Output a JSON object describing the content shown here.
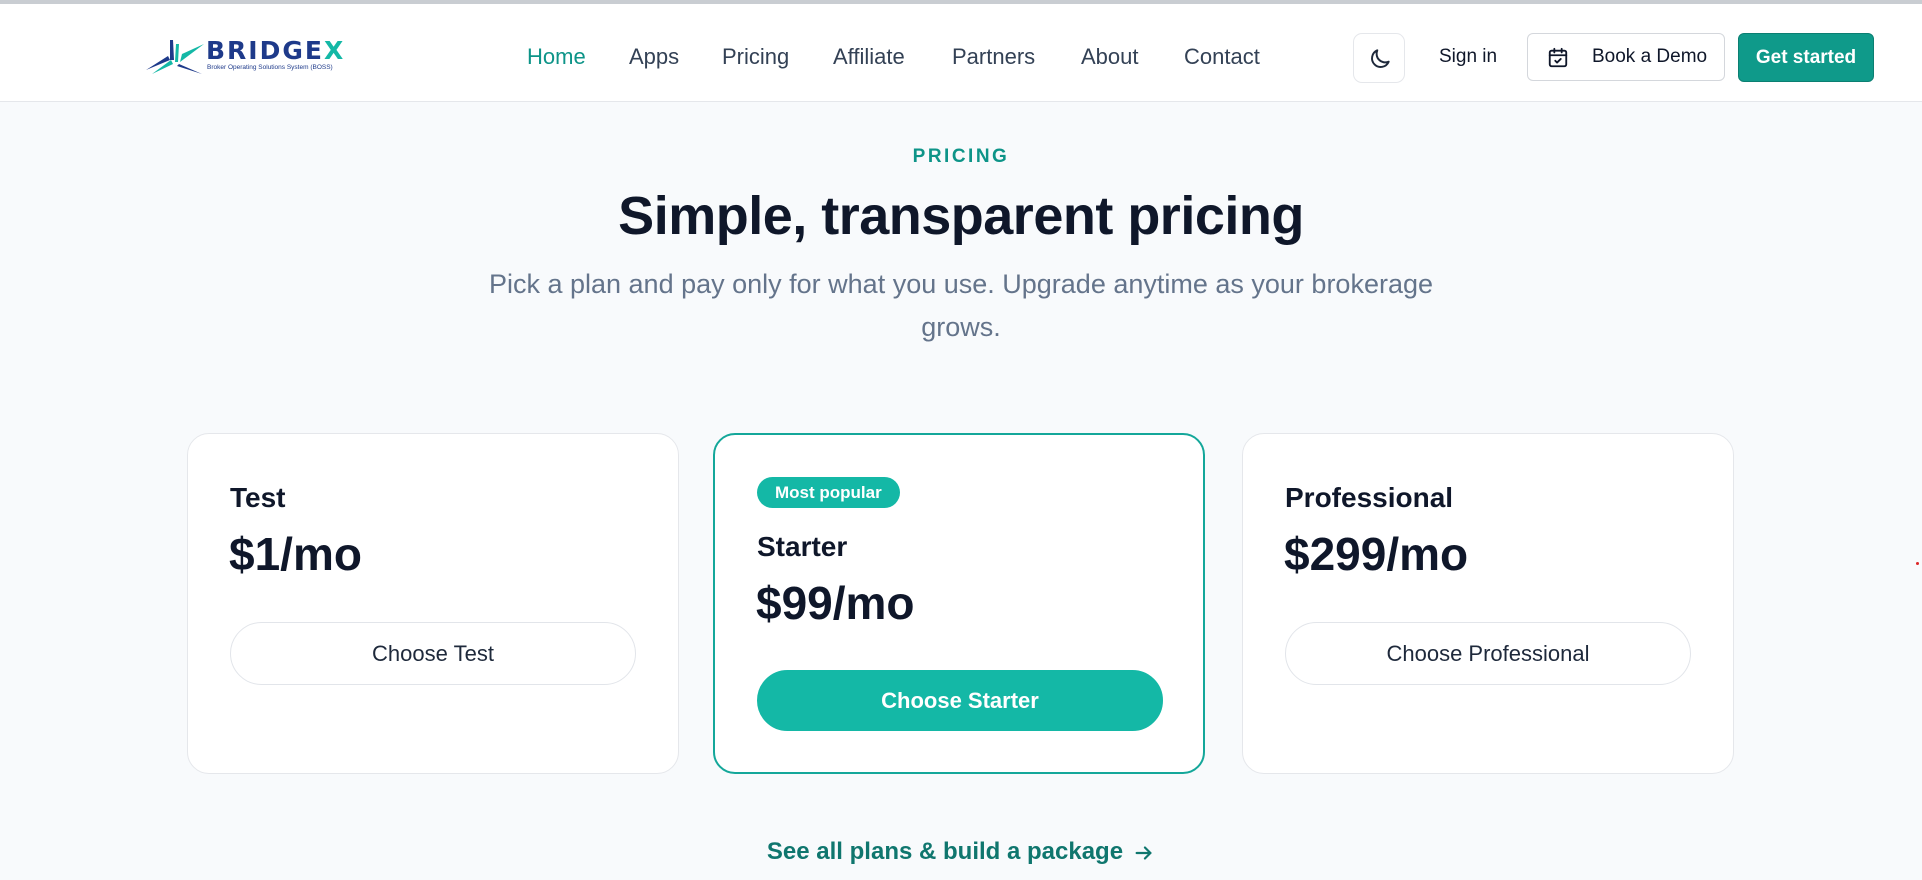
{
  "brand": {
    "name": "BRIDGE",
    "name_accent": "X",
    "tagline": "Broker Operating Solutions System (BOSS)"
  },
  "nav": {
    "items": [
      {
        "label": "Home",
        "active": true
      },
      {
        "label": "Apps",
        "active": false
      },
      {
        "label": "Pricing",
        "active": false
      },
      {
        "label": "Affiliate",
        "active": false
      },
      {
        "label": "Partners",
        "active": false
      },
      {
        "label": "About",
        "active": false
      },
      {
        "label": "Contact",
        "active": false
      }
    ],
    "theme_toggle_icon": "moon-icon",
    "signin_label": "Sign in",
    "demo_label": "Book a Demo",
    "demo_icon": "calendar-check-icon",
    "cta_label": "Get started"
  },
  "hero": {
    "eyebrow": "PRICING",
    "title": "Simple, transparent pricing",
    "subtitle": "Pick a plan and pay only for what you use. Upgrade anytime as your brokerage grows."
  },
  "plans": [
    {
      "name": "Test",
      "price": "$1/mo",
      "button": "Choose Test",
      "featured": false,
      "badge": ""
    },
    {
      "name": "Starter",
      "price": "$99/mo",
      "button": "Choose Starter",
      "featured": true,
      "badge": "Most popular"
    },
    {
      "name": "Professional",
      "price": "$299/mo",
      "button": "Choose Professional",
      "featured": false,
      "badge": ""
    }
  ],
  "footer_link": {
    "label": "See all plans & build a package",
    "icon": "arrow-right-icon"
  },
  "colors": {
    "accent": "#14b8a6",
    "accent_dark": "#0f9a8a",
    "brand_navy": "#1e3a8a",
    "heading": "#0f172a",
    "muted": "#64748b",
    "background": "#f8fafc"
  }
}
